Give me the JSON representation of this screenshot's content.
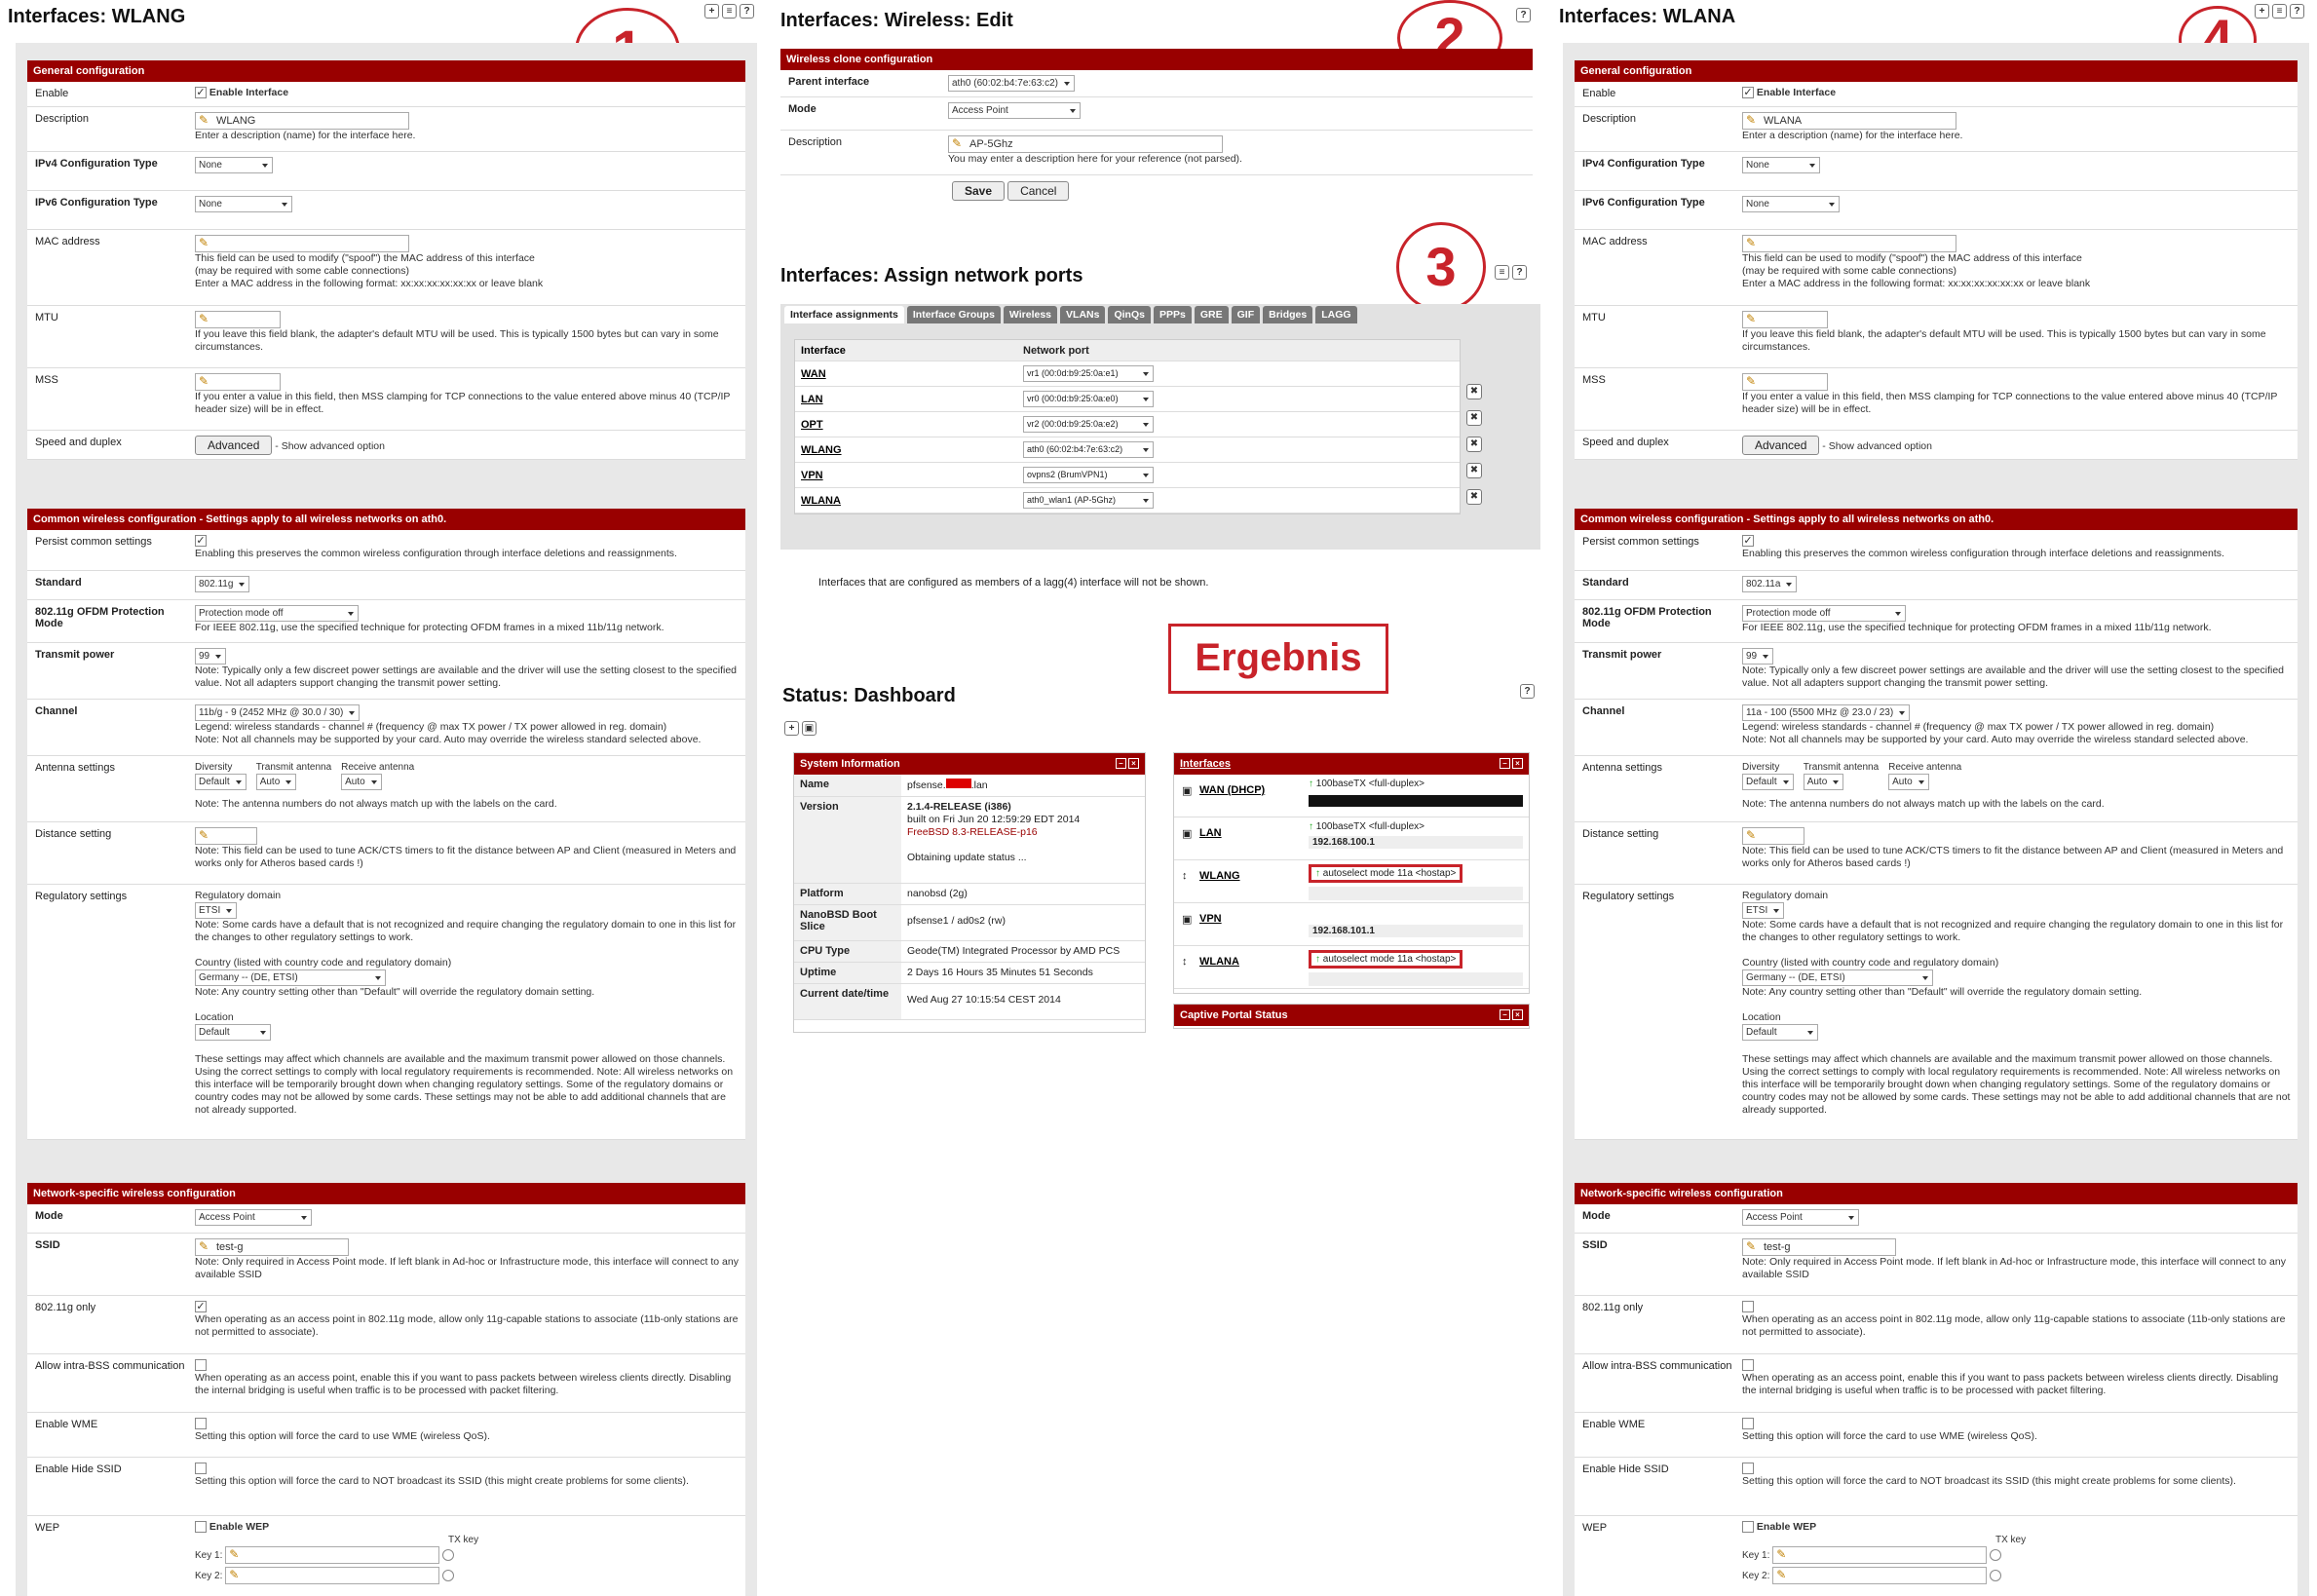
{
  "panel1": {
    "title": "Interfaces: WLANG",
    "marker": "1",
    "general": {
      "header": "General configuration",
      "enable_label": "Enable",
      "enable_text": "Enable Interface",
      "description_label": "Description",
      "description_value": "WLANG",
      "description_help": "Enter a description (name) for the interface here.",
      "ipv4_label": "IPv4 Configuration Type",
      "ipv4_value": "None",
      "ipv6_label": "IPv6 Configuration Type",
      "ipv6_value": "None",
      "mac_label": "MAC address",
      "mac_help1": "This field can be used to modify (\"spoof\") the MAC address of this interface",
      "mac_help2": "(may be required with some cable connections)",
      "mac_help3": "Enter a MAC address in the following format: xx:xx:xx:xx:xx:xx or leave blank",
      "mtu_label": "MTU",
      "mtu_help": "If you leave this field blank, the adapter's default MTU will be used. This is typically 1500 bytes but can vary in some circumstances.",
      "mss_label": "MSS",
      "mss_help": "If you enter a value in this field, then MSS clamping for TCP connections to the value entered above minus 40 (TCP/IP header size) will be in effect.",
      "speed_label": "Speed and duplex",
      "speed_button": "Advanced",
      "speed_help": "- Show advanced option"
    },
    "wireless": {
      "header": "Common wireless configuration - Settings apply to all wireless networks on ath0.",
      "persist_label": "Persist common settings",
      "persist_help": "Enabling this preserves the common wireless configuration through interface deletions and reassignments.",
      "standard_label": "Standard",
      "standard_value": "802.11g",
      "ofdm_label": "802.11g OFDM Protection Mode",
      "ofdm_value": "Protection mode off",
      "ofdm_help": "For IEEE 802.11g, use the specified technique for protecting OFDM frames in a mixed 11b/11g network.",
      "txpower_label": "Transmit power",
      "txpower_value": "99",
      "txpower_help": "Note: Typically only a few discreet power settings are available and the driver will use the setting closest to the specified value. Not all adapters support changing the transmit power setting.",
      "channel_label": "Channel",
      "channel_value": "11b/g - 9 (2452 MHz @ 30.0 / 30)",
      "channel_help1": "Legend: wireless standards - channel # (frequency @ max TX power / TX power allowed in reg. domain)",
      "channel_help2": "Note: Not all channels may be supported by your card. Auto may override the wireless standard selected above.",
      "antenna_label": "Antenna settings",
      "diversity_label": "Diversity",
      "diversity_value": "Default",
      "tx_antenna_label": "Transmit antenna",
      "tx_antenna_value": "Auto",
      "rx_antenna_label": "Receive antenna",
      "rx_antenna_value": "Auto",
      "antenna_help": "Note: The antenna numbers do not always match up with the labels on the card.",
      "distance_label": "Distance setting",
      "distance_help": "Note: This field can be used to tune ACK/CTS timers to fit the distance between AP and Client (measured in Meters and works only for Atheros based cards !)",
      "regulatory_label": "Regulatory settings",
      "reg_domain_label": "Regulatory domain",
      "reg_domain_value": "ETSI",
      "reg_domain_help": "Note: Some cards have a default that is not recognized and require changing the regulatory domain to one in this list for the changes to other regulatory settings to work.",
      "country_label": "Country (listed with country code and regulatory domain)",
      "country_value": "Germany -- (DE, ETSI)",
      "country_help": "Note: Any country setting other than \"Default\" will override the regulatory domain setting.",
      "location_label": "Location",
      "location_value": "Default",
      "reg_help": "These settings may affect which channels are available and the maximum transmit power allowed on those channels. Using the correct settings to comply with local regulatory requirements is recommended. Note: All wireless networks on this interface will be temporarily brought down when changing regulatory settings. Some of the regulatory domains or country codes may not be allowed by some cards. These settings may not be able to add additional channels that are not already supported."
    },
    "network": {
      "header": "Network-specific wireless configuration",
      "mode_label": "Mode",
      "mode_value": "Access Point",
      "ssid_label": "SSID",
      "ssid_value": "test-g",
      "ssid_help": "Note: Only required in Access Point mode. If left blank in Ad-hoc or Infrastructure mode, this interface will connect to any available SSID",
      "g_only_label": "802.11g only",
      "g_only_help": "When operating as an access point in 802.11g mode, allow only 11g-capable stations to associate (11b-only stations are not permitted to associate).",
      "intrabss_label": "Allow intra-BSS communication",
      "intrabss_help": "When operating as an access point, enable this if you want to pass packets between wireless clients directly. Disabling the internal bridging is useful when traffic is to be processed with packet filtering.",
      "wme_label": "Enable WME",
      "wme_help": "Setting this option will force the card to use WME (wireless QoS).",
      "hide_label": "Enable Hide SSID",
      "hide_help": "Setting this option will force the card to NOT broadcast its SSID (this might create problems for some clients).",
      "wep_label": "WEP",
      "wep_text": "Enable WEP",
      "txkey_label": "TX key",
      "key1_label": "Key 1:",
      "key2_label": "Key 2:"
    }
  },
  "panel2": {
    "title": "Interfaces: Wireless: Edit",
    "marker": "2",
    "header": "Wireless clone configuration",
    "parent_label": "Parent interface",
    "parent_value": "ath0 (60:02:b4:7e:63:c2)",
    "mode_label": "Mode",
    "mode_value": "Access Point",
    "desc_label": "Description",
    "desc_value": "AP-5Ghz",
    "desc_help": "You may enter a description here for your reference (not parsed).",
    "save_button": "Save",
    "cancel_button": "Cancel"
  },
  "panel3": {
    "title": "Interfaces: Assign network ports",
    "marker": "3",
    "tabs": [
      "Interface assignments",
      "Interface Groups",
      "Wireless",
      "VLANs",
      "QinQs",
      "PPPs",
      "GRE",
      "GIF",
      "Bridges",
      "LAGG"
    ],
    "col_interface": "Interface",
    "col_port": "Network port",
    "rows": [
      {
        "iface": "WAN",
        "port": "vr1 (00:0d:b9:25:0a:e1)"
      },
      {
        "iface": "LAN",
        "port": "vr0 (00:0d:b9:25:0a:e0)"
      },
      {
        "iface": "OPT",
        "port": "vr2 (00:0d:b9:25:0a:e2)"
      },
      {
        "iface": "WLANG",
        "port": "ath0 (60:02:b4:7e:63:c2)"
      },
      {
        "iface": "VPN",
        "port": "ovpns2 (BrumVPN1)"
      },
      {
        "iface": "WLANA",
        "port": "ath0_wlan1 (AP-5Ghz)"
      }
    ],
    "note": "Interfaces that are configured as members of a lagg(4) interface will not be shown."
  },
  "result_label": "Ergebnis",
  "dashboard": {
    "title": "Status: Dashboard",
    "sysinfo": {
      "header": "System Information",
      "name_label": "Name",
      "name_value_a": "pfsense.",
      "name_value_b": ".lan",
      "version_label": "Version",
      "version_1": "2.1.4-RELEASE (i386)",
      "version_2": "built on Fri Jun 20 12:59:29 EDT 2014",
      "version_3": "FreeBSD 8.3-RELEASE-p16",
      "version_4": "Obtaining update status ...",
      "platform_label": "Platform",
      "platform_value": "nanobsd (2g)",
      "boot_label": "NanoBSD Boot Slice",
      "boot_value": "pfsense1 / ad0s2 (rw)",
      "cpu_label": "CPU Type",
      "cpu_value": "Geode(TM) Integrated Processor by AMD PCS",
      "uptime_label": "Uptime",
      "uptime_value": "2 Days 16 Hours 35 Minutes 51 Seconds",
      "date_label": "Current date/time",
      "date_value": "Wed Aug 27 10:15:54 CEST 2014"
    },
    "interfaces": {
      "header": "Interfaces",
      "rows": [
        {
          "name": "WAN (DHCP)",
          "status": "100baseTX <full-duplex>",
          "ip": ""
        },
        {
          "name": "LAN",
          "status": "100baseTX <full-duplex>",
          "ip": "192.168.100.1"
        },
        {
          "name": "WLANG",
          "status": "autoselect mode 11a <hostap>",
          "ip": ""
        },
        {
          "name": "VPN",
          "status": "",
          "ip": "192.168.101.1"
        },
        {
          "name": "WLANA",
          "status": "autoselect mode 11a <hostap>",
          "ip": ""
        }
      ]
    },
    "captive": {
      "header": "Captive Portal Status"
    }
  },
  "panel4": {
    "title": "Interfaces: WLANA",
    "marker": "4",
    "description_value": "WLANA",
    "standard_value": "802.11a",
    "channel_value": "11a - 100 (5500 MHz @ 23.0 / 23)",
    "ssid_value": "test-g"
  },
  "colors": {
    "header_red": "#990000",
    "marker_red": "#c8232a",
    "panel_bg": "#e8e8e8"
  }
}
